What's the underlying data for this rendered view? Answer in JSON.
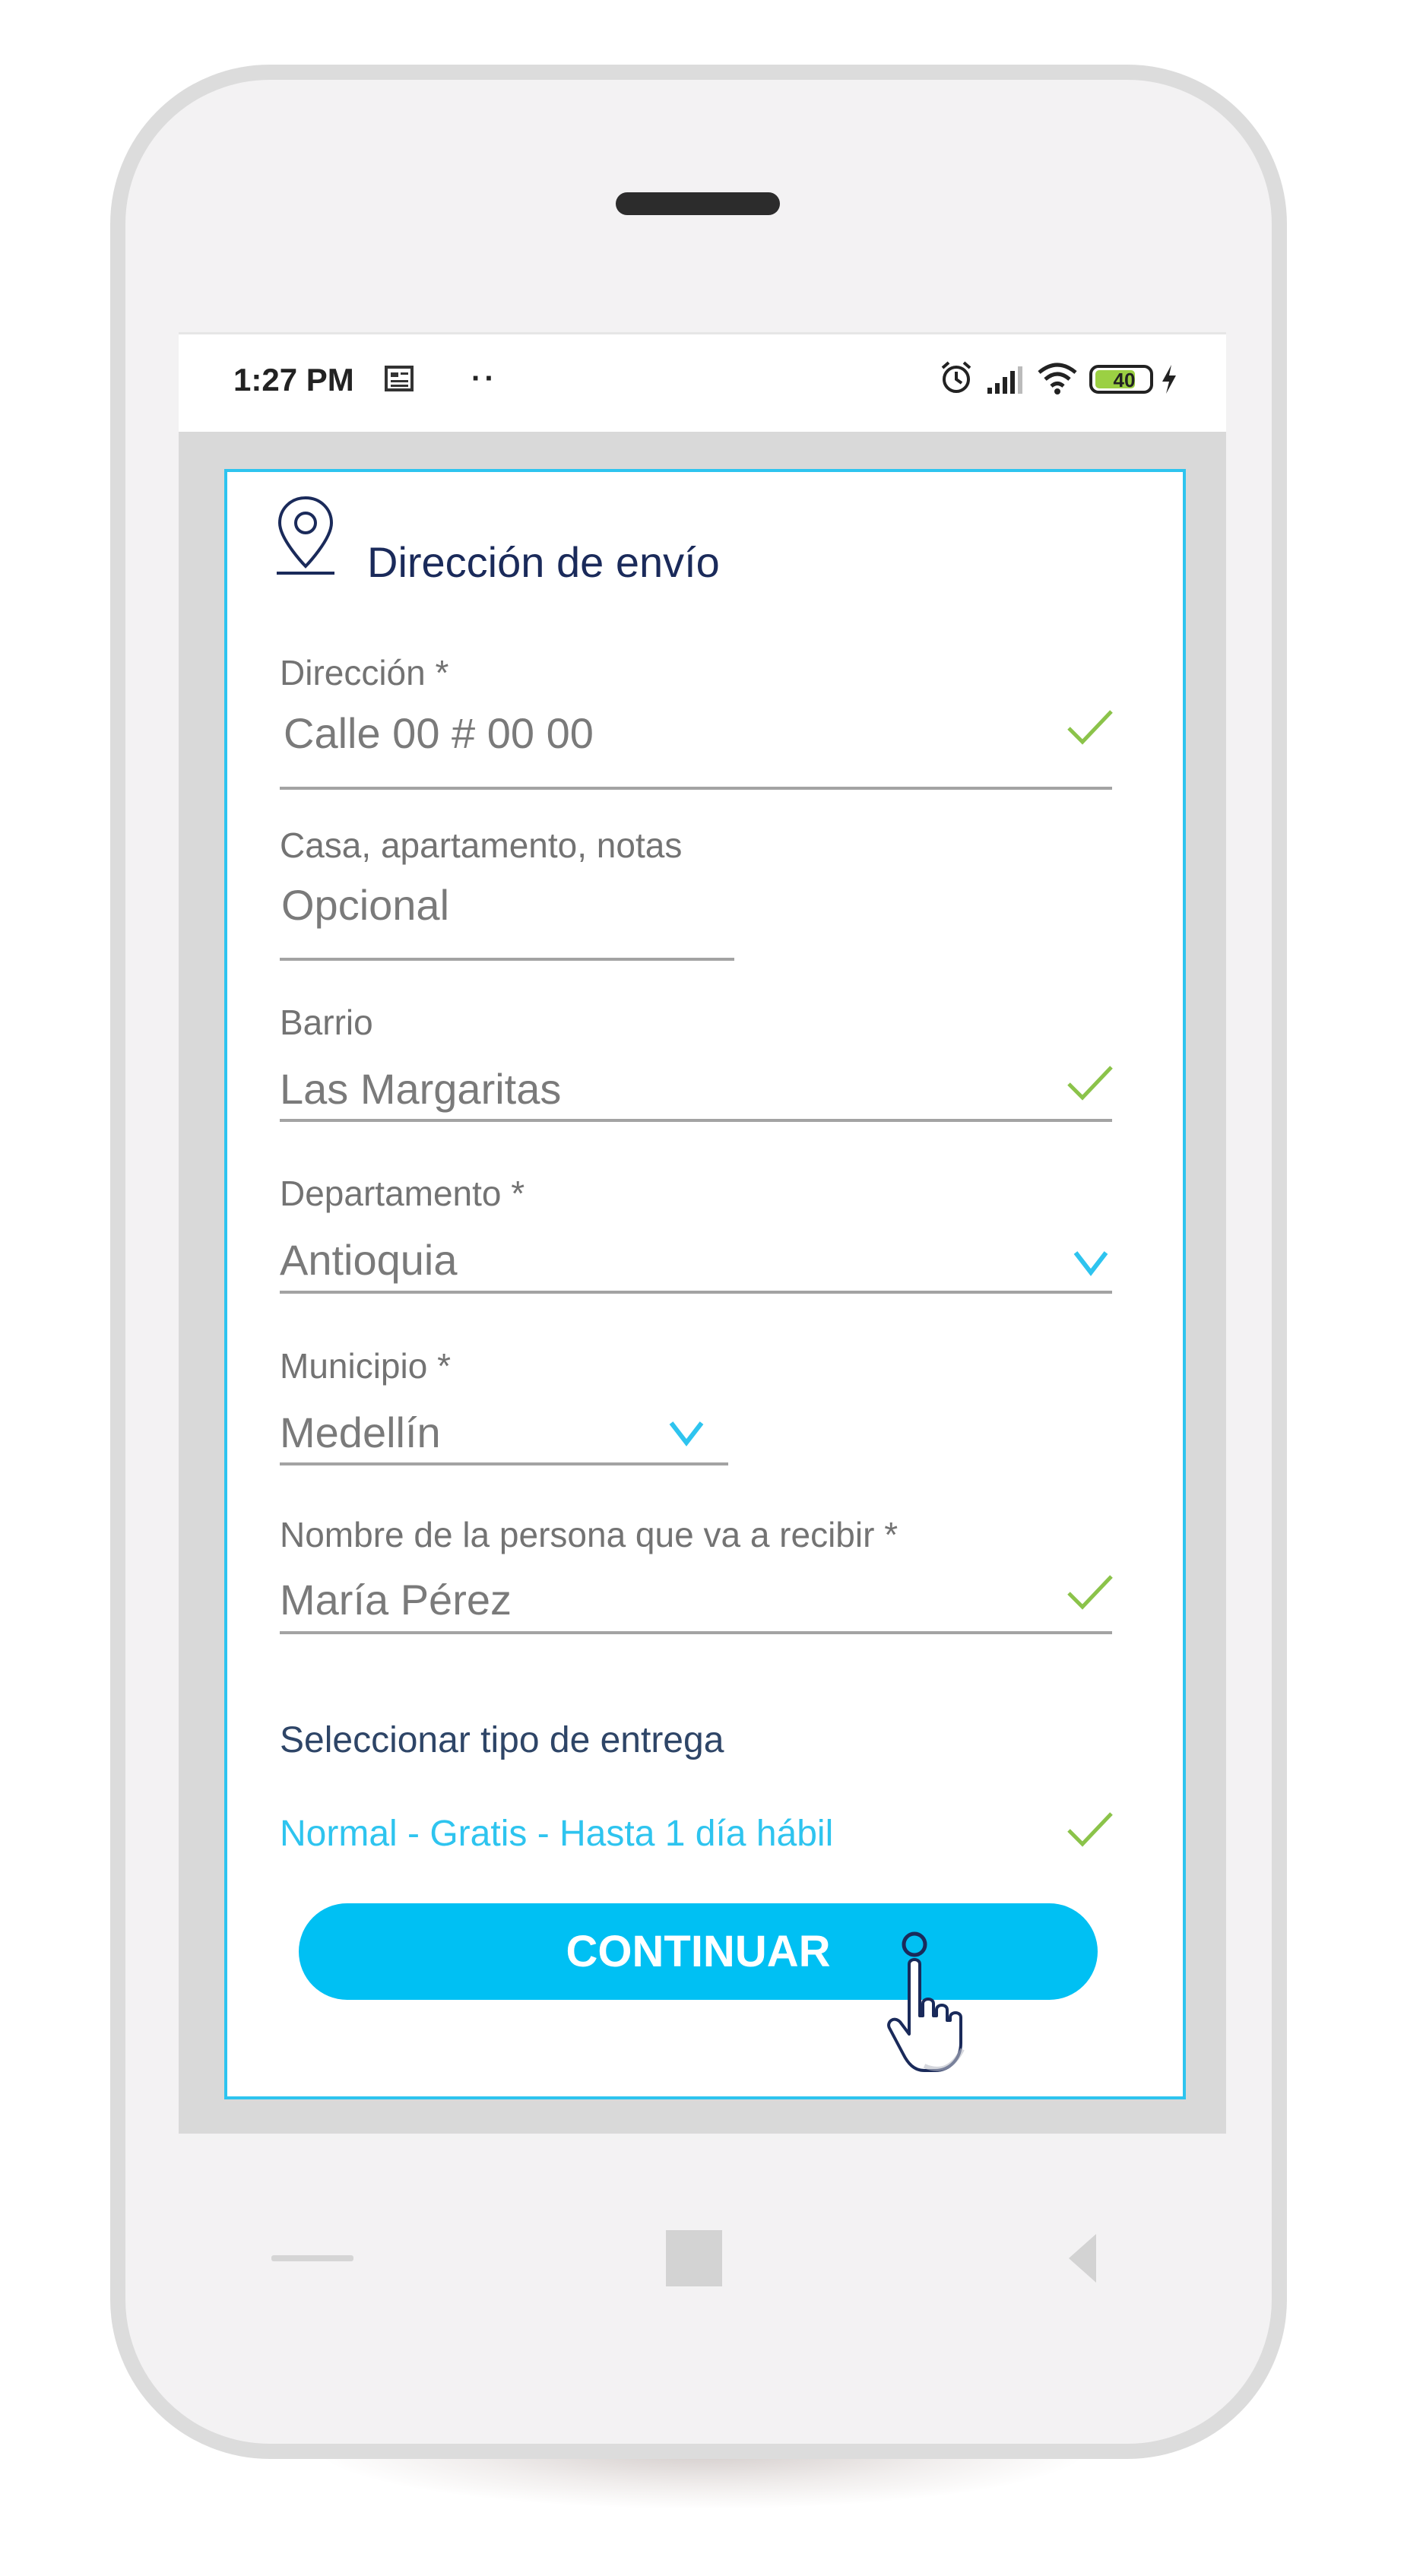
{
  "colors": {
    "accent": "#2ec4ef",
    "button": "#00c0f3",
    "check": "#8bc34a",
    "title": "#1a2a5a",
    "delivery_label": "#2e4567"
  },
  "status_bar": {
    "time": "1:27 PM",
    "dots": "··",
    "battery": "40",
    "icons": [
      "notification-icon",
      "alarm-icon",
      "signal-icon",
      "wifi-icon",
      "battery-icon",
      "charging-icon"
    ]
  },
  "section": {
    "icon": "location-pin-icon",
    "title": "Dirección de envío"
  },
  "form": {
    "direccion": {
      "label": "Dirección *",
      "value": "Calle 00  # 00 00",
      "valid": true
    },
    "casa": {
      "label": "Casa, apartamento, notas",
      "placeholder": "Opcional"
    },
    "barrio": {
      "label": "Barrio",
      "value": "Las Margaritas",
      "valid": true
    },
    "departamento": {
      "label": "Departamento *",
      "value": "Antioquia"
    },
    "municipio": {
      "label": "Municipio *",
      "value": "Medellín"
    },
    "receptor": {
      "label": "Nombre de la persona que va a recibir *",
      "value": "María Pérez",
      "valid": true
    }
  },
  "delivery": {
    "label": "Seleccionar tipo de entrega",
    "option": "Normal - Gratis - Hasta 1 día hábil",
    "selected": true
  },
  "continue_button": "CONTINUAR",
  "nav_icons": [
    "back-nav-icon",
    "home-nav-icon",
    "recent-nav-icon"
  ]
}
